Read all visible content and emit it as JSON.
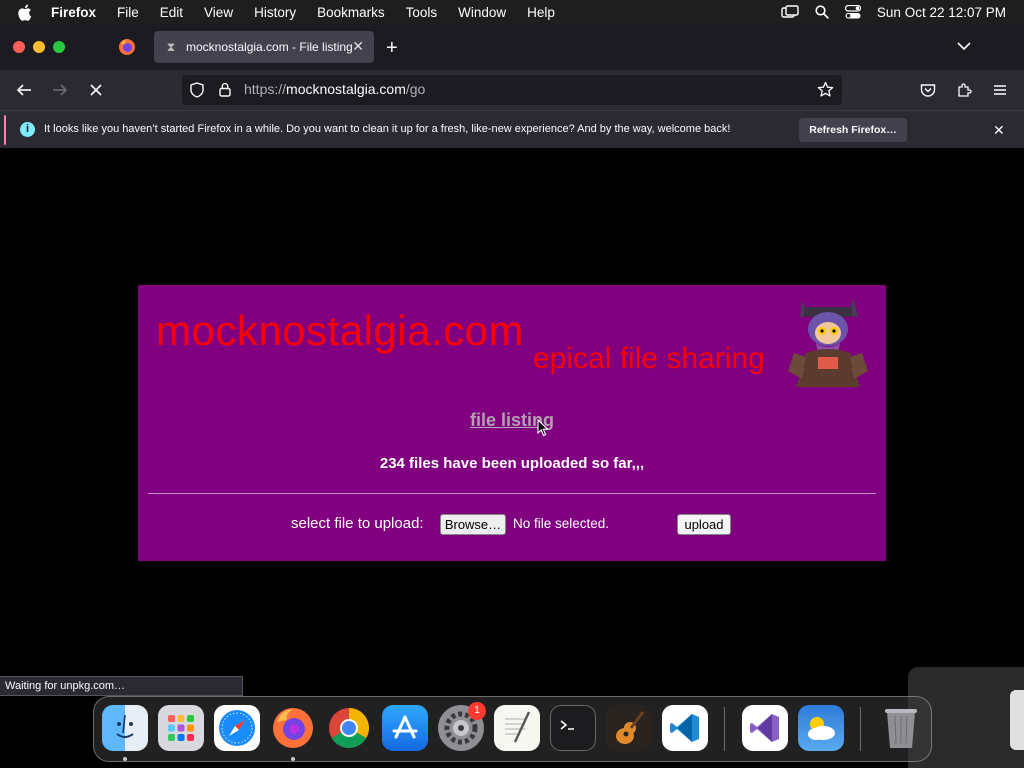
{
  "menubar": {
    "app_name": "Firefox",
    "items": [
      "File",
      "Edit",
      "View",
      "History",
      "Bookmarks",
      "Tools",
      "Window",
      "Help"
    ],
    "clock": "Sun Oct 22  12:07 PM"
  },
  "browser": {
    "tab_title": "mocknostalgia.com - File listing",
    "url_prefix": "https://",
    "url_host": "mocknostalgia.com",
    "url_path": "/go",
    "notification_text": "It looks like you haven’t started Firefox in a while. Do you want to clean it up for a fresh, like-new experience? And by the way, welcome back!",
    "notification_button": "Refresh Firefox…",
    "status_text": "Waiting for unpkg.com…"
  },
  "page": {
    "site_title": "mocknostalgia.com",
    "tagline": "epical file sharing",
    "file_listing_link": "file listing",
    "file_count_text": "234 files have been uploaded so far,,,",
    "upload_label": "select file to upload:",
    "browse_button": "Browse…",
    "no_file_text": "No file selected.",
    "upload_button": "upload"
  },
  "dock": {
    "apps": [
      "finder-icon",
      "launchpad-icon",
      "safari-icon",
      "firefox-icon",
      "chrome-icon",
      "app-store-icon",
      "system-settings-icon",
      "textedit-icon",
      "terminal-icon",
      "garageband-icon",
      "vscode-icon",
      "visual-studio-icon",
      "weather-icon",
      "trash-icon"
    ],
    "settings_badge": "1"
  },
  "colors": {
    "panel_bg": "#800080",
    "title_red": "#ff0000",
    "browser_dark": "#2b2a33"
  }
}
